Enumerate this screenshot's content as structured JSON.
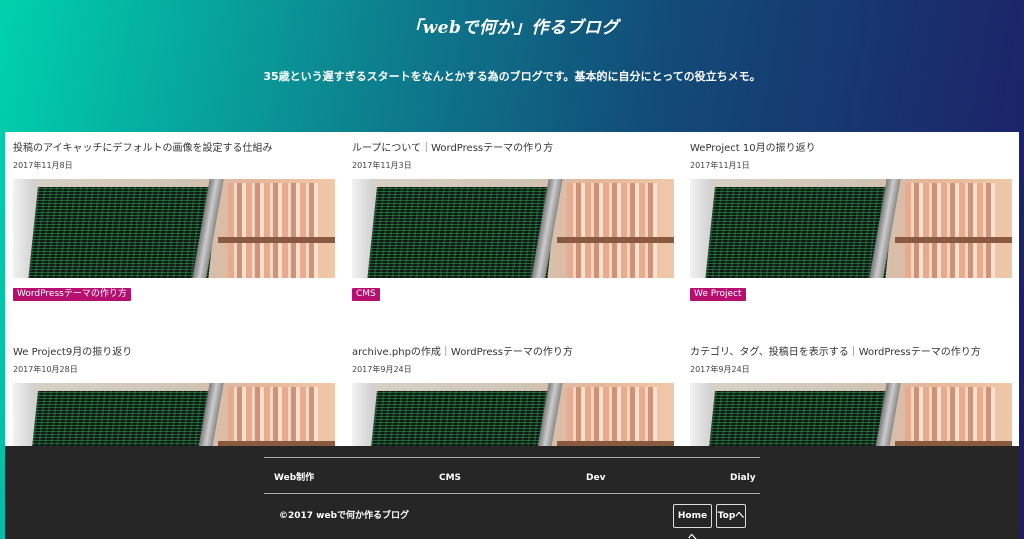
{
  "header": {
    "title": "「webで何か」作るブログ",
    "tagline": "35歳という遅すぎるスタートをなんとかする為のブログです。基本的に自分にとっての役立ちメモ。"
  },
  "posts": [
    {
      "title": "投稿のアイキャッチにデフォルトの画像を設定する仕組み",
      "date": "2017年11月8日",
      "tag": "WordPressテーマの作り方"
    },
    {
      "title": "ループについて｜WordPressテーマの作り方",
      "date": "2017年11月3日",
      "tag": "CMS"
    },
    {
      "title": "WeProject 10月の振り返り",
      "date": "2017年11月1日",
      "tag": "We Project"
    },
    {
      "title": "We Project9月の振り返り",
      "date": "2017年10月28日",
      "tag": ""
    },
    {
      "title": "archive.phpの作成｜WordPressテーマの作り方",
      "date": "2017年9月24日",
      "tag": ""
    },
    {
      "title": "カテゴリ、タグ、投稿日を表示する｜WordPressテーマの作り方",
      "date": "2017年9月24日",
      "tag": ""
    }
  ],
  "footer": {
    "nav": [
      "Web制作",
      "CMS",
      "Dev",
      "Dialy"
    ],
    "copyright": "©2017 webで何か作るブログ",
    "home_label": "Homeへ",
    "top_label": "Topへ"
  },
  "colors": {
    "tag_bg": "#b5106f",
    "footer_bg": "#262626",
    "gradient_start": "#00d1ad",
    "gradient_end": "#1e1c66"
  }
}
